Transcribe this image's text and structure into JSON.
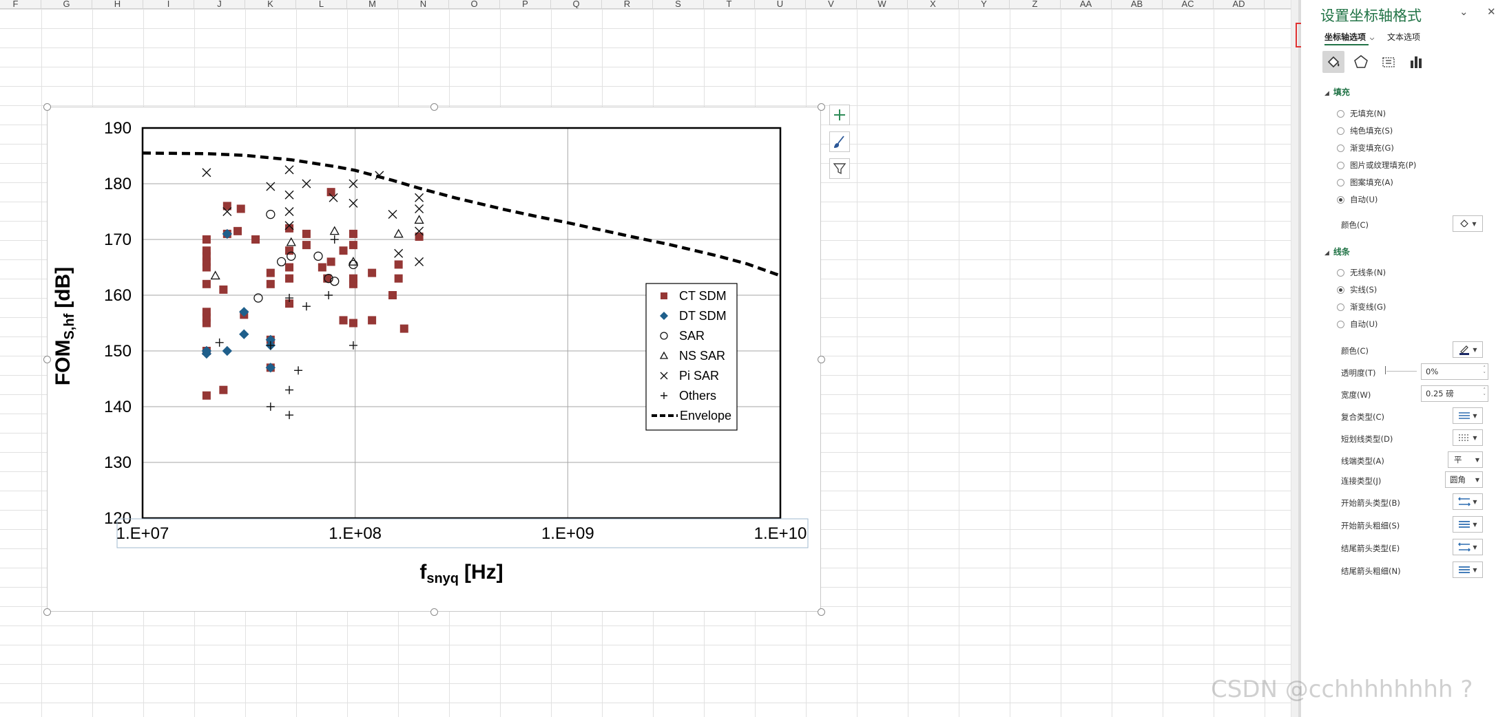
{
  "columns": [
    "F",
    "G",
    "H",
    "I",
    "J",
    "K",
    "L",
    "M",
    "N",
    "O",
    "P",
    "Q",
    "R",
    "S",
    "T",
    "U",
    "V",
    "W",
    "X",
    "Y",
    "Z",
    "AA",
    "AB",
    "AC",
    "AD"
  ],
  "chart_data": {
    "type": "scatter",
    "title": "",
    "xlabel_main": "f",
    "xlabel_sub": "snyq",
    "xlabel_unit": "[Hz]",
    "ylabel_main": "FOM",
    "ylabel_sub": "S,hf",
    "ylabel_unit": "[dB]",
    "x_scale": "log",
    "xlim": [
      10000000,
      10000000000
    ],
    "ylim": [
      120,
      190
    ],
    "x_ticks": [
      10000000,
      100000000,
      1000000000,
      10000000000
    ],
    "x_tick_labels": [
      "1.E+07",
      "1.E+08",
      "1.E+09",
      "1.E+10"
    ],
    "y_ticks": [
      120,
      130,
      140,
      150,
      160,
      170,
      180,
      190
    ],
    "y_tick_labels": [
      "120",
      "130",
      "140",
      "150",
      "160",
      "170",
      "180",
      "190"
    ],
    "grid": true,
    "legend_position": "right",
    "series": [
      {
        "name": "CT SDM",
        "marker": "square",
        "color": "#953735",
        "points": [
          [
            20000000,
            142
          ],
          [
            20000000,
            150
          ],
          [
            20000000,
            155
          ],
          [
            20000000,
            156
          ],
          [
            20000000,
            157
          ],
          [
            20000000,
            162
          ],
          [
            20000000,
            165
          ],
          [
            20000000,
            166
          ],
          [
            20000000,
            167
          ],
          [
            20000000,
            168
          ],
          [
            20000000,
            170
          ],
          [
            24000000,
            143
          ],
          [
            24000000,
            161
          ],
          [
            25000000,
            171
          ],
          [
            25000000,
            176
          ],
          [
            28000000,
            171.5
          ],
          [
            29000000,
            175.5
          ],
          [
            30000000,
            156.5
          ],
          [
            34000000,
            170
          ],
          [
            40000000,
            147
          ],
          [
            40000000,
            152
          ],
          [
            40000000,
            162
          ],
          [
            40000000,
            164
          ],
          [
            49000000,
            158.5
          ],
          [
            49000000,
            163
          ],
          [
            49000000,
            165
          ],
          [
            49000000,
            168
          ],
          [
            49000000,
            172
          ],
          [
            59000000,
            169
          ],
          [
            59000000,
            171
          ],
          [
            70000000,
            165
          ],
          [
            74000000,
            163
          ],
          [
            77000000,
            166
          ],
          [
            77000000,
            178.5
          ],
          [
            88000000,
            155.5
          ],
          [
            88000000,
            168
          ],
          [
            98000000,
            155
          ],
          [
            98000000,
            162
          ],
          [
            98000000,
            163
          ],
          [
            98000000,
            169
          ],
          [
            98000000,
            171
          ],
          [
            120000000,
            155.5
          ],
          [
            120000000,
            164
          ],
          [
            150000000,
            160
          ],
          [
            160000000,
            163
          ],
          [
            160000000,
            165.5
          ],
          [
            170000000,
            154
          ],
          [
            200000000,
            170.5
          ]
        ]
      },
      {
        "name": "DT SDM",
        "marker": "diamond",
        "color": "#1f5f8b",
        "points": [
          [
            20000000,
            149.5
          ],
          [
            20000000,
            150
          ],
          [
            25000000,
            150
          ],
          [
            25000000,
            171
          ],
          [
            30000000,
            153
          ],
          [
            30000000,
            157
          ],
          [
            40000000,
            151
          ],
          [
            40000000,
            152
          ],
          [
            40000000,
            147
          ]
        ]
      },
      {
        "name": "SAR",
        "marker": "circle",
        "color": "#111111",
        "points": [
          [
            35000000,
            159.5
          ],
          [
            40000000,
            174.5
          ],
          [
            45000000,
            166
          ],
          [
            50000000,
            167
          ],
          [
            67000000,
            167
          ],
          [
            75000000,
            163
          ],
          [
            80000000,
            162.5
          ],
          [
            98000000,
            165.5
          ]
        ]
      },
      {
        "name": "NS SAR",
        "marker": "triangle",
        "color": "#111111",
        "points": [
          [
            22000000,
            163.5
          ],
          [
            50000000,
            169.5
          ],
          [
            80000000,
            171.5
          ],
          [
            98000000,
            166
          ],
          [
            160000000,
            171
          ],
          [
            200000000,
            173.5
          ]
        ]
      },
      {
        "name": "Pi SAR",
        "marker": "x",
        "color": "#111111",
        "points": [
          [
            20000000,
            182
          ],
          [
            25000000,
            175
          ],
          [
            40000000,
            179.5
          ],
          [
            49000000,
            172.5
          ],
          [
            49000000,
            175
          ],
          [
            49000000,
            178
          ],
          [
            49000000,
            182.5
          ],
          [
            59000000,
            180
          ],
          [
            79000000,
            177.5
          ],
          [
            98000000,
            176.5
          ],
          [
            98000000,
            180
          ],
          [
            130000000,
            181.5
          ],
          [
            150000000,
            174.5
          ],
          [
            160000000,
            167.5
          ],
          [
            200000000,
            166
          ],
          [
            200000000,
            171.5
          ],
          [
            200000000,
            175.5
          ],
          [
            200000000,
            177.5
          ]
        ]
      },
      {
        "name": "Others",
        "marker": "plus",
        "color": "#111111",
        "points": [
          [
            23000000,
            151.5
          ],
          [
            40000000,
            140
          ],
          [
            40000000,
            151
          ],
          [
            49000000,
            138.5
          ],
          [
            49000000,
            143
          ],
          [
            49000000,
            159.5
          ],
          [
            54000000,
            146.5
          ],
          [
            59000000,
            158
          ],
          [
            75000000,
            160
          ],
          [
            80000000,
            170
          ],
          [
            98000000,
            151
          ]
        ]
      },
      {
        "name": "Envelope",
        "line": "dashed",
        "color": "#000000",
        "points": [
          [
            10000000,
            185.5
          ],
          [
            20000000,
            185.4
          ],
          [
            30000000,
            185.1
          ],
          [
            50000000,
            184.3
          ],
          [
            80000000,
            183.1
          ],
          [
            100000000,
            182.4
          ],
          [
            150000000,
            180.6
          ],
          [
            200000000,
            179.2
          ],
          [
            300000000,
            177.4
          ],
          [
            500000000,
            175.4
          ],
          [
            700000000,
            174.2
          ],
          [
            1000000000,
            173.0
          ],
          [
            2000000000,
            170.5
          ],
          [
            3000000000,
            169.1
          ],
          [
            5000000000,
            167.1
          ],
          [
            7000000000,
            165.6
          ],
          [
            10000000000,
            163.5
          ]
        ]
      }
    ]
  },
  "pane": {
    "title": "设置坐标轴格式",
    "tab_axis": "坐标轴选项",
    "tab_text": "文本选项",
    "fill_header": "填充",
    "fill_options": [
      "无填充(N)",
      "纯色填充(S)",
      "渐变填充(G)",
      "图片或纹理填充(P)",
      "图案填充(A)",
      "自动(U)"
    ],
    "fill_selected": 5,
    "fill_color_label": "颜色(C)",
    "line_header": "线条",
    "line_options": [
      "无线条(N)",
      "实线(S)",
      "渐变线(G)",
      "自动(U)"
    ],
    "line_selected": 1,
    "props": {
      "color": "颜色(C)",
      "transparency": "透明度(T)",
      "transparency_value": "0%",
      "width": "宽度(W)",
      "width_value": "0.25 磅",
      "compound": "复合类型(C)",
      "dash": "短划线类型(D)",
      "cap": "线端类型(A)",
      "cap_value": "平",
      "join": "连接类型(J)",
      "join_value": "圆角",
      "begin_arrow_type": "开始箭头类型(B)",
      "begin_arrow_size": "开始箭头粗细(S)",
      "end_arrow_type": "结尾箭头类型(E)",
      "end_arrow_size": "结尾箭头粗细(N)"
    }
  },
  "watermark": "CSDN @cchhhhhhhh ?",
  "colors": {
    "accent": "#217346",
    "highlight_box": "#e03131"
  }
}
